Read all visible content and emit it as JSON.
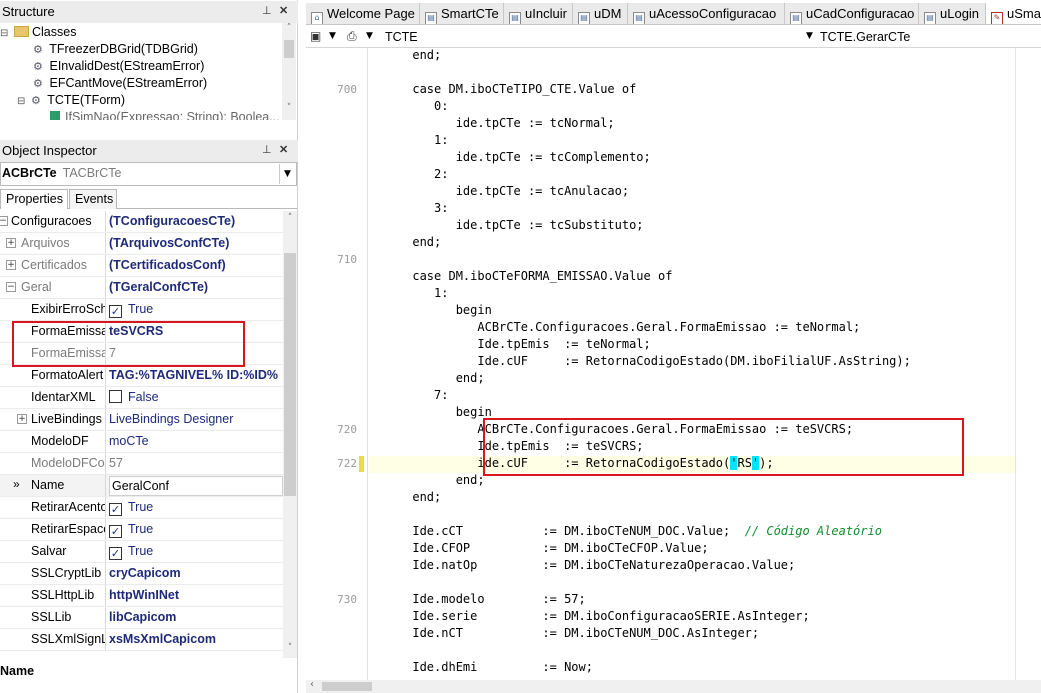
{
  "structure": {
    "title": "Structure",
    "items": [
      {
        "label": "Classes",
        "glyph": "⊟"
      },
      {
        "label": "TFreezerDBGrid(TDBGrid)"
      },
      {
        "label": "EInvalidDest(EStreamError)"
      },
      {
        "label": "EFCantMove(EStreamError)"
      },
      {
        "label": "TCTE(TForm)",
        "glyph": "⊟"
      },
      {
        "label": "IfSimNao(Expressao: String): Boolea..."
      }
    ]
  },
  "object_inspector": {
    "title": "Object Inspector",
    "selected_object": "ACBrCTe",
    "selected_class": "TACBrCTe",
    "tabs": [
      "Properties",
      "Events"
    ],
    "properties": [
      {
        "name": "Configuracoes",
        "value": "(TConfiguracoesCTe)"
      },
      {
        "name": "Arquivos",
        "value": "(TArquivosConfCTe)"
      },
      {
        "name": "Certificados",
        "value": "(TCertificadosConf)"
      },
      {
        "name": "Geral",
        "value": "(TGeralConfCTe)"
      },
      {
        "name": "ExibirErroSch",
        "value": "True"
      },
      {
        "name": "FormaEmissa",
        "value": "teSVCRS"
      },
      {
        "name": "FormaEmissa",
        "value": "7"
      },
      {
        "name": "FormatoAlert",
        "value": "TAG:%TAGNIVEL% ID:%ID%"
      },
      {
        "name": "IdentarXML",
        "value": "False"
      },
      {
        "name": "LiveBindings",
        "value": "LiveBindings Designer"
      },
      {
        "name": "ModeloDF",
        "value": "moCTe"
      },
      {
        "name": "ModeloDFCo",
        "value": "57"
      },
      {
        "name": "Name",
        "value": "GeralConf"
      },
      {
        "name": "RetirarAcento",
        "value": "True"
      },
      {
        "name": "RetirarEspaco",
        "value": "True"
      },
      {
        "name": "Salvar",
        "value": "True"
      },
      {
        "name": "SSLCryptLib",
        "value": "cryCapicom"
      },
      {
        "name": "SSLHttpLib",
        "value": "httpWinINet"
      },
      {
        "name": "SSLLib",
        "value": "libCapicom"
      },
      {
        "name": "SSLXmlSignLi",
        "value": "xsMsXmlCapicom"
      }
    ],
    "status": "Name"
  },
  "editor": {
    "tabs": [
      "Welcome Page",
      "SmartCTe",
      "uIncluir",
      "uDM",
      "uAcessoConfiguracao",
      "uCadConfiguracao",
      "uLogin",
      "uSma"
    ],
    "toolbar": {
      "unit_combo": "TCTE",
      "method_combo": "TCTE.GerarCTe"
    },
    "line_numbers": [
      "700",
      "710",
      "720",
      "722",
      "730"
    ],
    "code_lines": [
      "      end;",
      "",
      "      case DM.iboCTeTIPO_CTE.Value of",
      "         0:",
      "            ide.tpCTe := tcNormal;",
      "         1:",
      "            ide.tpCTe := tcComplemento;",
      "         2:",
      "            ide.tpCTe := tcAnulacao;",
      "         3:",
      "            ide.tpCTe := tcSubstituto;",
      "      end;",
      "",
      "      case DM.iboCTeFORMA_EMISSAO.Value of",
      "         1:",
      "            begin",
      "               ACBrCTe.Configuracoes.Geral.FormaEmissao := teNormal;",
      "               Ide.tpEmis  := teNormal;",
      "               Ide.cUF     := RetornaCodigoEstado(DM.iboFilialUF.AsString);",
      "            end;",
      "         7:",
      "            begin",
      "               ACBrCTe.Configuracoes.Geral.FormaEmissao := teSVCRS;",
      "               Ide.tpEmis  := teSVCRS;",
      "               ide.cUF     := RetornaCodigoEstado(",
      "            end;",
      "      end;",
      "",
      "      Ide.cCT           := DM.iboCTeNUM_DOC.Value;  ",
      "      Ide.CFOP          := DM.iboCTeCFOP.Value;",
      "      Ide.natOp         := DM.iboCTeNaturezaOperacao.Value;",
      "",
      "      Ide.modelo        := 57;",
      "      Ide.serie         := DM.iboConfiguracaoSERIE.AsInteger;",
      "      Ide.nCT           := DM.iboCTeNUM_DOC.AsInteger;",
      "",
      "      Ide.dhEmi         := Now;"
    ],
    "line_722_quote_open": "'",
    "line_722_literal": "RS",
    "line_722_quote_close": "'",
    "line_722_tail": ");",
    "comment_text": "// Código Aleatório"
  },
  "colors": {
    "highlight_box": "#d9161e",
    "string_match": "#00e5ff",
    "comment": "#148d2e"
  }
}
